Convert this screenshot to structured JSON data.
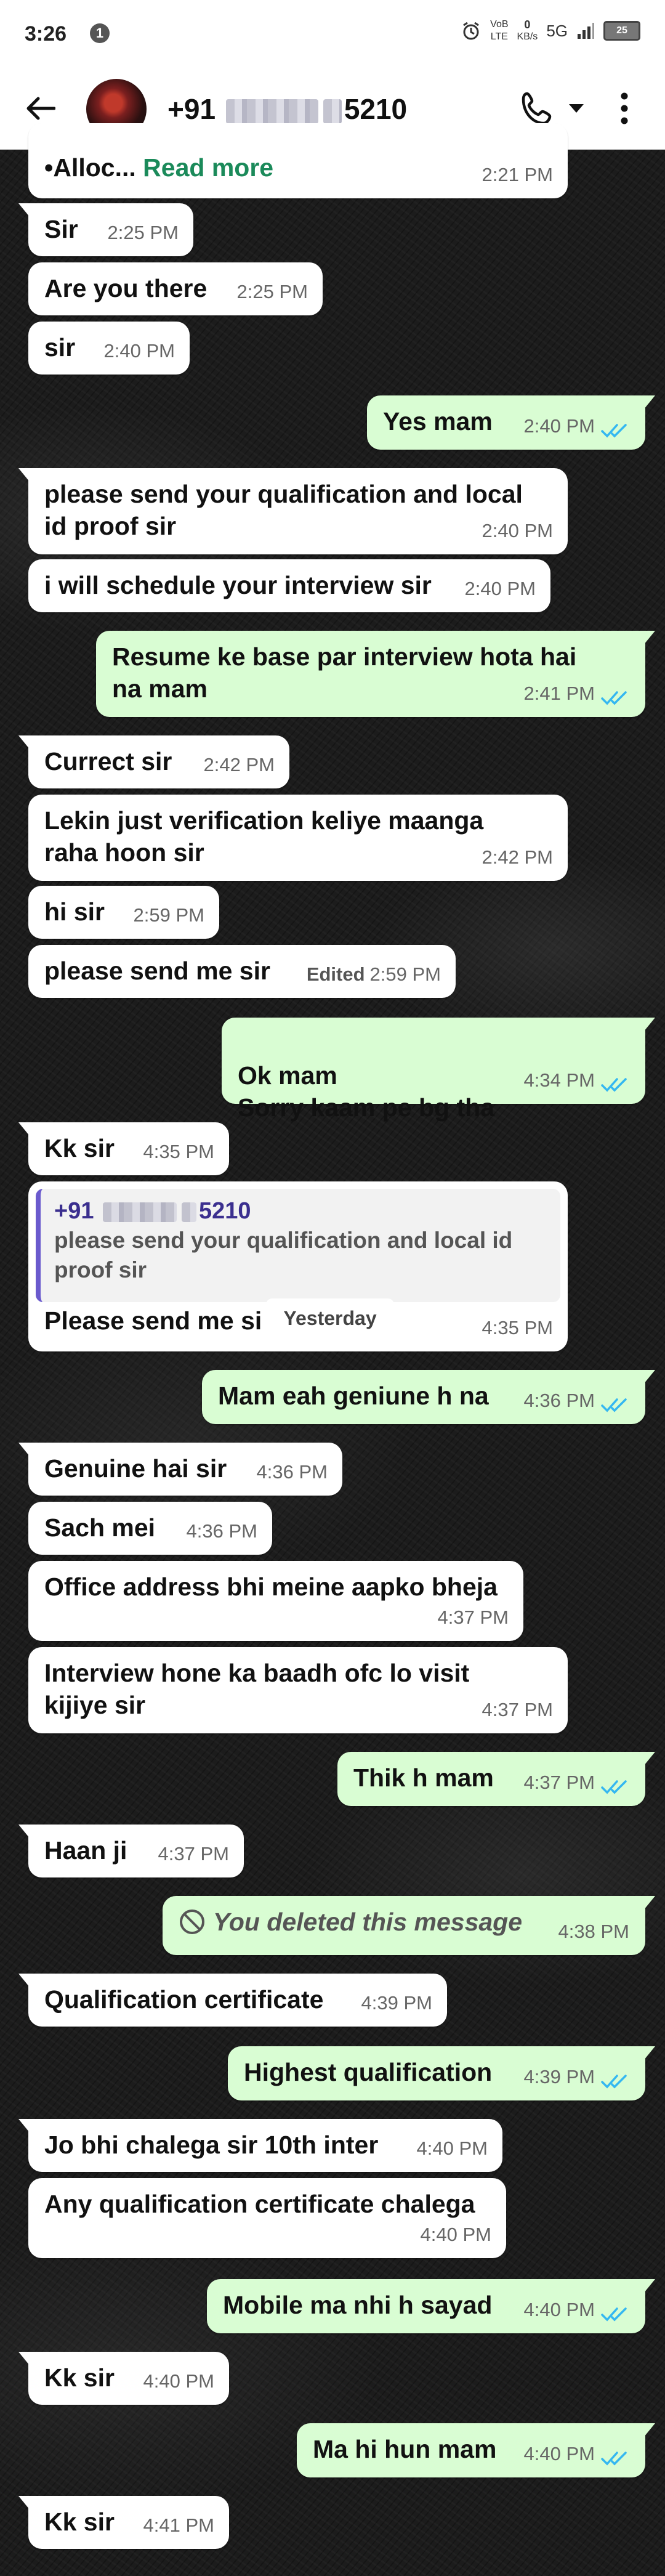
{
  "status_bar": {
    "time": "3:26",
    "notification_count": "1",
    "net_top": "VoB",
    "net_lte": "LTE",
    "data_rate": "0",
    "data_unit": "KB/s",
    "network": "5G",
    "battery": "25"
  },
  "header": {
    "contact_prefix": "+91",
    "contact_suffix": "5210"
  },
  "messages": [
    {
      "text_prefix": "•Alloc...",
      "read_more": "Read more",
      "time": "2:21 PM"
    },
    {
      "text": "Sir",
      "time": "2:25 PM"
    },
    {
      "text": "Are you there",
      "time": "2:25 PM"
    },
    {
      "text": "sir",
      "time": "2:40 PM"
    },
    {
      "text": "Yes mam",
      "time": "2:40 PM"
    },
    {
      "text": "please send your qualification and local id proof sir",
      "time": "2:40 PM"
    },
    {
      "text": "i will schedule your interview sir",
      "time": "2:40 PM"
    },
    {
      "text": "Resume ke base par interview hota hai na mam",
      "time": "2:41 PM"
    },
    {
      "text": "Currect sir",
      "time": "2:42 PM"
    },
    {
      "text": "Lekin just verification keliye maanga raha hoon sir",
      "time": "2:42 PM"
    },
    {
      "text": "hi sir",
      "time": "2:59 PM"
    },
    {
      "text": "please send me sir",
      "edited": "Edited",
      "time": "2:59 PM"
    },
    {
      "text": "Ok mam\nSorry kaam pe bg tha",
      "time": "4:34 PM"
    },
    {
      "text": "Kk sir",
      "time": "4:35 PM"
    },
    {
      "quote_name_prefix": "+91",
      "quote_name_suffix": "5210",
      "quote_text": "please send your qualification and local id proof sir",
      "text": "Please send me si",
      "time": "4:35 PM"
    },
    {
      "text": "Mam eah geniune h na",
      "time": "4:36 PM"
    },
    {
      "text": "Genuine hai sir",
      "time": "4:36 PM"
    },
    {
      "text": "Sach mei",
      "time": "4:36 PM"
    },
    {
      "text": "Office address bhi meine aapko bheja",
      "time": "4:37 PM"
    },
    {
      "text": "Interview hone ka baadh ofc lo visit kijiye sir",
      "time": "4:37 PM"
    },
    {
      "text": "Thik h mam",
      "time": "4:37 PM"
    },
    {
      "text": "Haan ji",
      "time": "4:37 PM"
    },
    {
      "text": "You deleted this message",
      "time": "4:38 PM"
    },
    {
      "text": "Qualification certificate",
      "time": "4:39 PM"
    },
    {
      "text": "Highest qualification",
      "time": "4:39 PM"
    },
    {
      "text": "Jo bhi chalega sir 10th inter",
      "time": "4:40 PM"
    },
    {
      "text": "Any qualification certificate chalega",
      "time": "4:40 PM"
    },
    {
      "text": "Mobile ma nhi h sayad",
      "time": "4:40 PM"
    },
    {
      "text": "Kk sir",
      "time": "4:40 PM"
    },
    {
      "text": "Ma hi hun mam",
      "time": "4:40 PM"
    },
    {
      "text": "Kk sir",
      "time": "4:41 PM"
    }
  ],
  "date_pill": "Yesterday",
  "colors": {
    "incoming_bubble": "#ffffff",
    "outgoing_bubble": "#d9fdd3",
    "read_tick": "#34b7f1",
    "read_more_link": "#1b8a5a",
    "quote_bar": "#6a5acd"
  },
  "icons": [
    "back-arrow-icon",
    "phone-icon",
    "chevron-down-icon",
    "more-vert-icon",
    "double-tick-icon",
    "ban-icon"
  ]
}
